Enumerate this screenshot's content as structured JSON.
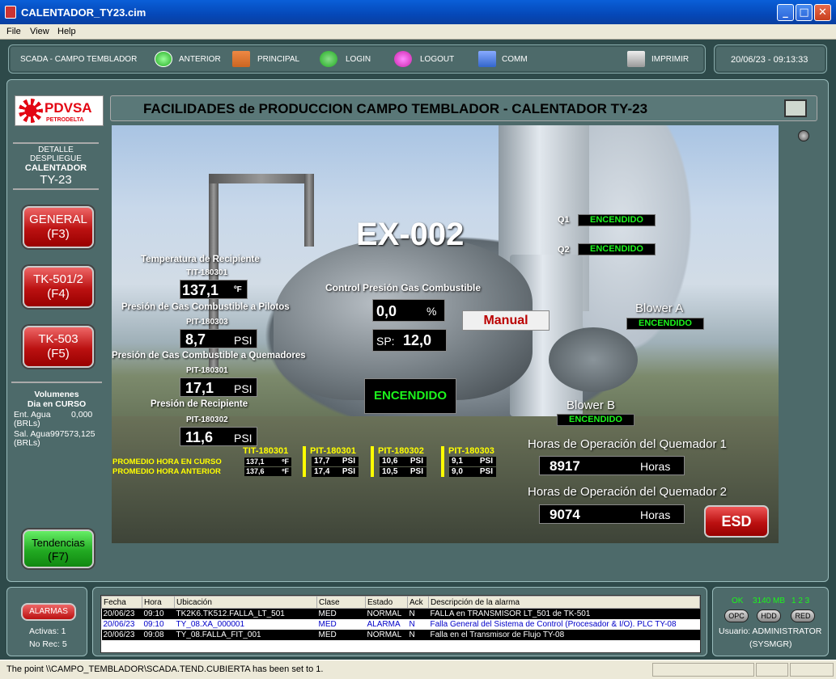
{
  "window": {
    "title": "CALENTADOR_TY23.cim"
  },
  "menu": {
    "items": [
      "File",
      "View",
      "Help"
    ]
  },
  "nav": {
    "site": "SCADA - CAMPO TEMBLADOR",
    "back": "ANTERIOR",
    "home": "PRINCIPAL",
    "login": "LOGIN",
    "logout": "LOGOUT",
    "comm": "COMM",
    "print": "IMPRIMIR",
    "datetime": "20/06/23 - 09:13:33"
  },
  "logo": {
    "brand": "PDVSA",
    "sub": "PETRODELTA"
  },
  "sidebar": {
    "detail": [
      "DETALLE",
      "DESPLIEGUE",
      "CALENTADOR",
      "TY-23"
    ],
    "buttons": [
      {
        "label": "GENERAL",
        "key": "(F3)"
      },
      {
        "label": "TK-501/2",
        "key": "(F4)"
      },
      {
        "label": "TK-503",
        "key": "(F5)"
      }
    ],
    "volumes": {
      "title1": "Volumenes",
      "title2": "Dia en CURSO",
      "in_label": "Ent. Agua",
      "in_unit": "(BRLs)",
      "in_value": "0,000",
      "out_label": "Sal. Agua",
      "out_unit": "(BRLs)",
      "out_value": "997573,125"
    },
    "trend": {
      "label": "Tendencias",
      "key": "(F7)"
    }
  },
  "header": {
    "title": "FACILIDADES de PRODUCCION CAMPO TEMBLADOR - CALENTADOR TY-23"
  },
  "scene": {
    "equipment": "EX-002",
    "q1": {
      "label": "Q1",
      "status": "ENCENDIDO"
    },
    "q2": {
      "label": "Q2",
      "status": "ENCENDIDO"
    },
    "temp": {
      "label": "Temperatura de Recipiente",
      "tag": "TIT-180301",
      "value": "137,1",
      "unit": "ºF"
    },
    "pilot": {
      "label": "Presión de Gas Combustible a Pilotos",
      "tag": "PIT-180303",
      "value": "8,7",
      "unit": "PSI"
    },
    "burner": {
      "label": "Presión de Gas Combustible a Quemadores",
      "tag": "PIT-180301",
      "value": "17,1",
      "unit": "PSI"
    },
    "vessel": {
      "label": "Presión de Recipiente",
      "tag": "PIT-180302",
      "value": "11,6",
      "unit": "PSI"
    },
    "control": {
      "label": "Control Presión Gas Combustible",
      "value": "0,0",
      "unit": "%",
      "sp_label": "SP:",
      "sp_value": "12,0",
      "mode": "Manual"
    },
    "main_status": "ENCENDIDO",
    "blowerA": {
      "label": "Blower A",
      "status": "ENCENDIDO"
    },
    "blowerB": {
      "label": "Blower B",
      "status": "ENCENDIDO"
    },
    "hours1": {
      "label": "Horas de Operación del Quemador 1",
      "value": "8917",
      "unit": "Horas"
    },
    "hours2": {
      "label": "Horas de Operación del Quemador 2",
      "value": "9074",
      "unit": "Horas"
    },
    "esd": "ESD",
    "avg": {
      "row1": "PROMEDIO HORA EN CURSO",
      "row2": "PROMEDIO HORA ANTERIOR",
      "cols": [
        {
          "tag": "TIT-180301",
          "cur": "137,1",
          "prev": "137,6",
          "unit": "ºF"
        },
        {
          "tag": "PIT-180301",
          "cur": "17,7",
          "prev": "17,4",
          "unit": "PSI"
        },
        {
          "tag": "PIT-180302",
          "cur": "10,6",
          "prev": "10,5",
          "unit": "PSI"
        },
        {
          "tag": "PIT-180303",
          "cur": "9,1",
          "prev": "9,0",
          "unit": "PSI"
        }
      ]
    }
  },
  "alarms": {
    "button": "ALARMAS",
    "active": "Activas: 1",
    "unack": "No Rec: 5",
    "columns": [
      "Fecha",
      "Hora",
      "Ubicación",
      "Clase",
      "Estado",
      "Ack",
      "Descripción de la alarma"
    ],
    "rows": [
      [
        "20/06/23",
        "09:10",
        "TK2K6.TK512.FALLA_LT_501",
        "MED",
        "NORMAL",
        "N",
        "FALLA en TRANSMISOR LT_501 de TK-501"
      ],
      [
        "20/06/23",
        "09:10",
        "TY_08.XA_000001",
        "MED",
        "ALARMA",
        "N",
        "Falla General del Sistema de Control (Procesador & I/O). PLC TY-08"
      ],
      [
        "20/06/23",
        "09:08",
        "TY_08.FALLA_FIT_001",
        "MED",
        "NORMAL",
        "N",
        "Falla en el Transmisor de Flujo TY-08"
      ]
    ]
  },
  "sys": {
    "ok": "OK",
    "mem": "3140 MB",
    "nums": "1 2 3",
    "opc": "OPC",
    "hdd": "HDD",
    "red": "RED",
    "user": "Usuario: ADMINISTRATOR",
    "group": "(SYSMGR)"
  },
  "status": {
    "message": "The point \\\\CAMPO_TEMBLADOR\\SCADA.TEND.CUBIERTA has been set to 1."
  }
}
